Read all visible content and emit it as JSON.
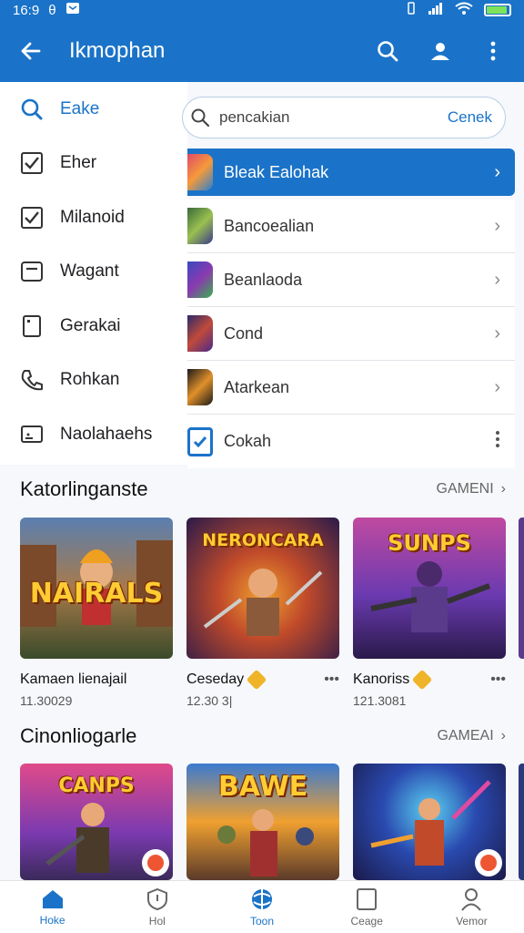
{
  "status": {
    "time": "16:9",
    "alt": "θ"
  },
  "appbar": {
    "title": "Ikmophan"
  },
  "drawer": {
    "items": [
      {
        "label": "Eake",
        "icon": "search-icon"
      },
      {
        "label": "Eher",
        "icon": "checkbox-icon"
      },
      {
        "label": "Milanoid",
        "icon": "checkbox-icon"
      },
      {
        "label": "Wagant",
        "icon": "minus-box-icon"
      },
      {
        "label": "Gerakai",
        "icon": "device-icon"
      },
      {
        "label": "Rohkan",
        "icon": "phone-icon"
      },
      {
        "label": "Naolahaehs",
        "icon": "cast-icon"
      }
    ]
  },
  "search": {
    "placeholder": "pencakian",
    "button": "Cenek"
  },
  "list": {
    "rows": [
      {
        "label": "Bleak Ealohak",
        "selected": true
      },
      {
        "label": "Bancoealian"
      },
      {
        "label": "Beanlaoda"
      },
      {
        "label": "Cond"
      },
      {
        "label": "Atarkean"
      },
      {
        "label": "Cokah"
      }
    ]
  },
  "section1": {
    "title": "Katorlinganste",
    "link": "GAMENI",
    "cards": [
      {
        "art_title": "NAIRALS",
        "name": "Kamaen lienajail",
        "meta": "11.30029"
      },
      {
        "art_title": "NERONCARA",
        "name": "Ceseday",
        "meta": "12.30 3|"
      },
      {
        "art_title": "SUNPS",
        "name": "Kanoriss",
        "meta": "121.3081"
      }
    ]
  },
  "section2": {
    "title": "Cinonliogarle",
    "link": "GAMEAI",
    "cards": [
      {
        "art_title": "CANPS"
      },
      {
        "art_title": "BAWE"
      },
      {
        "art_title": ""
      }
    ]
  },
  "bottomnav": [
    {
      "label": "Hoke",
      "icon": "home-icon"
    },
    {
      "label": "Hol",
      "icon": "shield-icon"
    },
    {
      "label": "Toon",
      "icon": "globe-icon"
    },
    {
      "label": "Ceage",
      "icon": "tablet-icon"
    },
    {
      "label": "Vemor",
      "icon": "person-icon"
    }
  ],
  "colors": {
    "primary": "#1a73c8",
    "background": "#f6f8fb"
  }
}
